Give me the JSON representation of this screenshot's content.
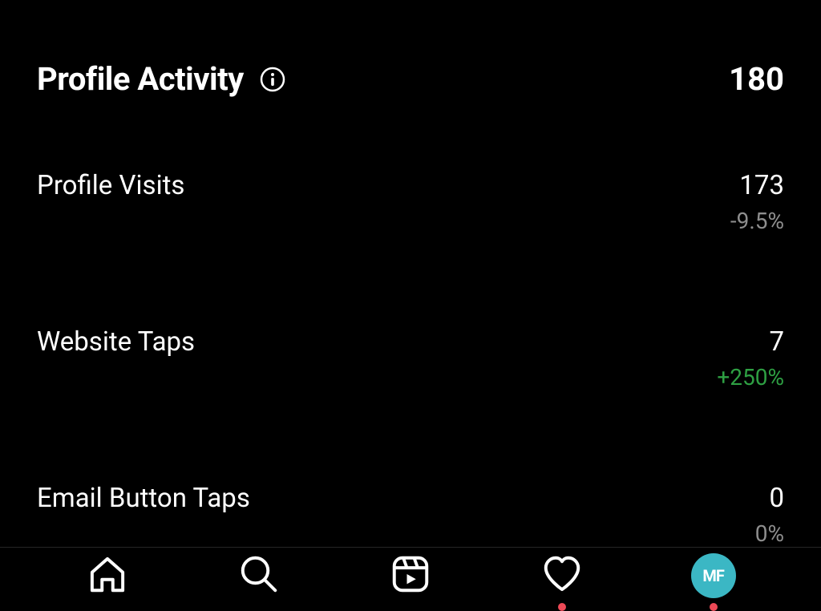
{
  "header": {
    "title": "Profile Activity",
    "total": "180"
  },
  "metrics": [
    {
      "label": "Profile Visits",
      "value": "173",
      "change": "-9.5%",
      "changeClass": "change-gray"
    },
    {
      "label": "Website Taps",
      "value": "7",
      "change": "+250%",
      "changeClass": "change-green"
    },
    {
      "label": "Email Button Taps",
      "value": "0",
      "change": "0%",
      "changeClass": "change-gray"
    }
  ],
  "avatar": {
    "initials": "MF"
  }
}
